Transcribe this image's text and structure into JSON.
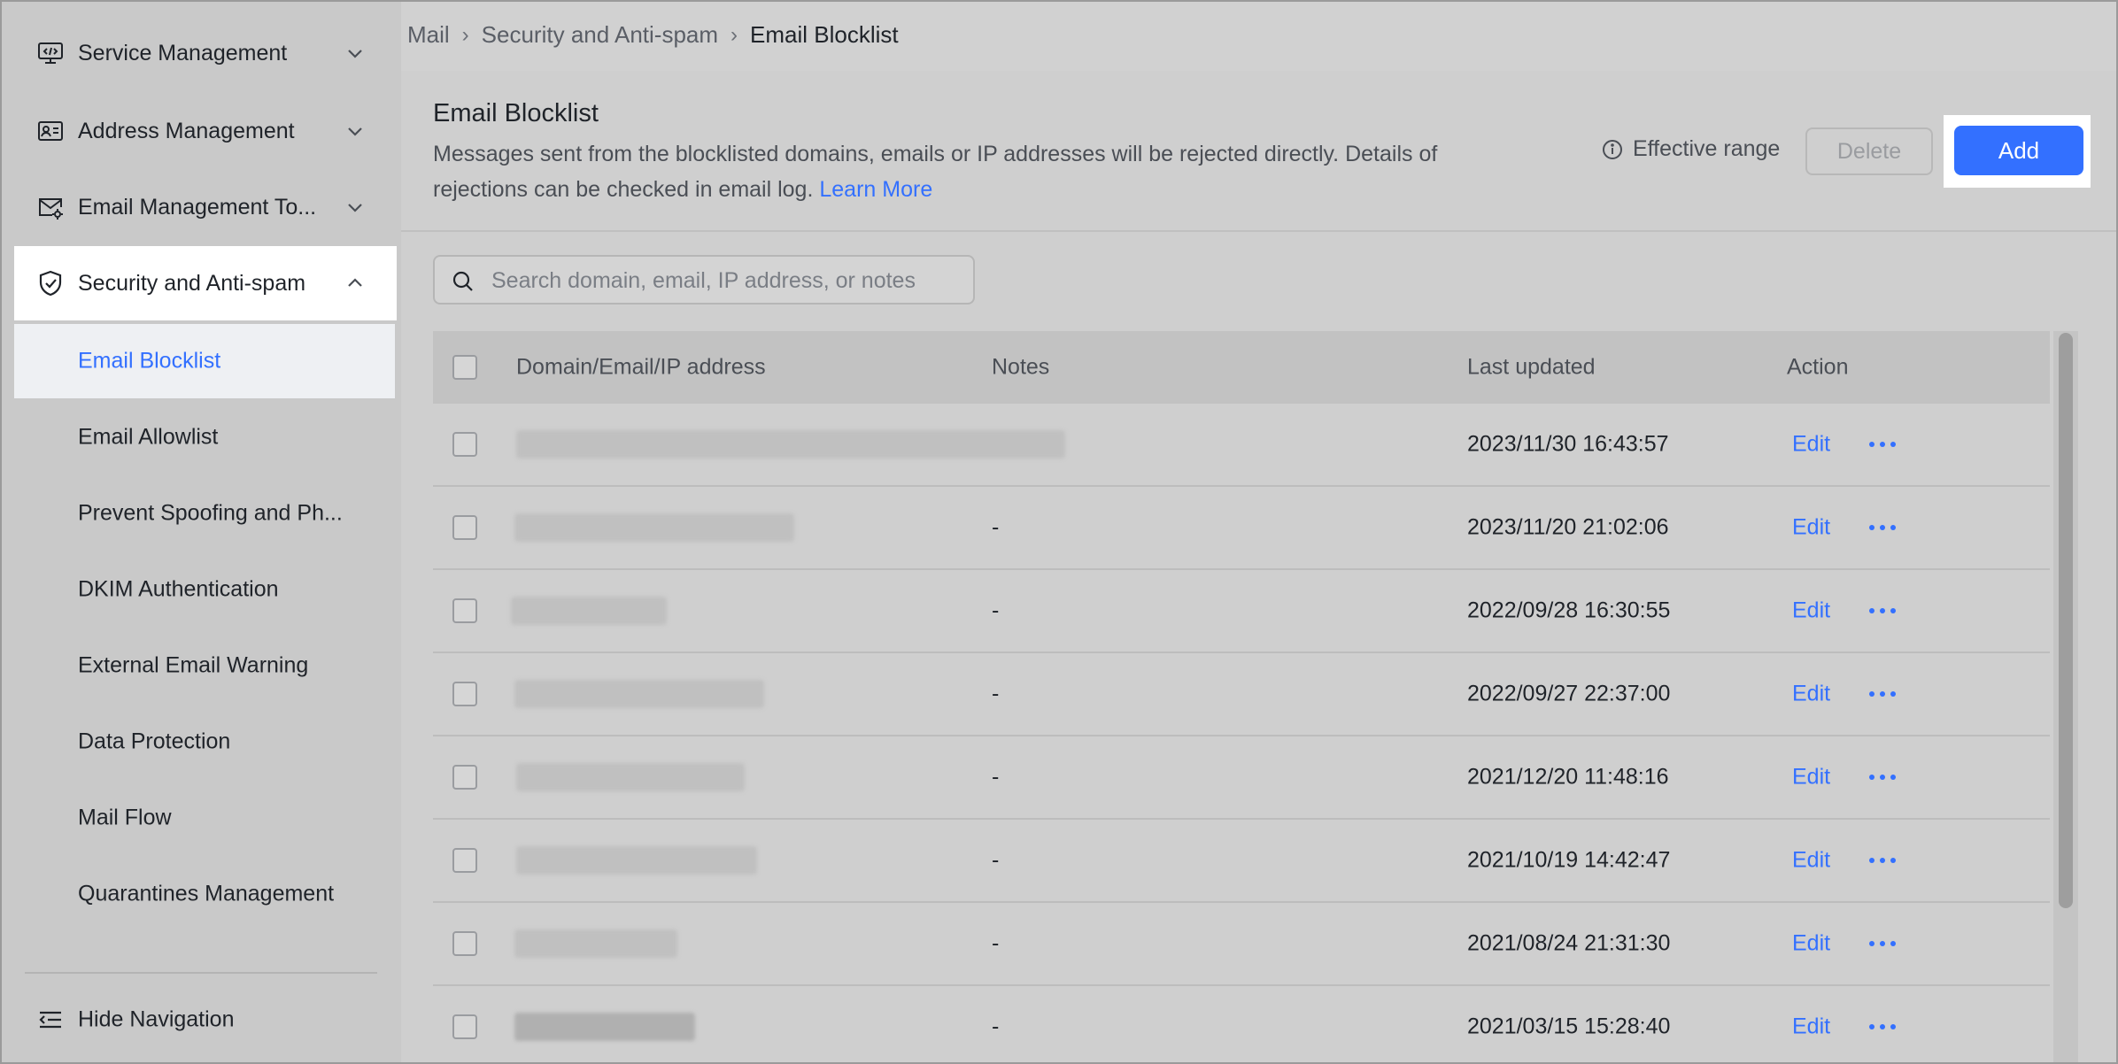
{
  "sidebar": {
    "items": [
      {
        "label": "Service Management",
        "icon": "monitor-code-icon",
        "expanded": false
      },
      {
        "label": "Address Management",
        "icon": "contact-card-icon",
        "expanded": false
      },
      {
        "label": "Email Management To...",
        "icon": "mail-settings-icon",
        "expanded": false
      },
      {
        "label": "Security and Anti-spam",
        "icon": "shield-check-icon",
        "expanded": true
      }
    ],
    "sub_items": [
      {
        "label": "Email Blocklist",
        "selected": true
      },
      {
        "label": "Email Allowlist"
      },
      {
        "label": "Prevent Spoofing and Ph..."
      },
      {
        "label": "DKIM Authentication"
      },
      {
        "label": "External Email Warning"
      },
      {
        "label": "Data Protection"
      },
      {
        "label": "Mail Flow"
      },
      {
        "label": "Quarantines Management"
      }
    ],
    "hide_nav_label": "Hide Navigation"
  },
  "breadcrumb": [
    "Mail",
    "Security and Anti-spam",
    "Email Blocklist"
  ],
  "header": {
    "title": "Email Blocklist",
    "description": "Messages sent from the blocklisted domains, emails or IP addresses will be rejected directly. Details of rejections can be checked in email log.",
    "learn_more": "Learn More",
    "effective_range": "Effective range",
    "delete_label": "Delete",
    "add_label": "Add"
  },
  "search": {
    "placeholder": "Search domain, email, IP address, or notes"
  },
  "table": {
    "columns": [
      "Domain/Email/IP address",
      "Notes",
      "Last updated",
      "Action"
    ],
    "edit_label": "Edit",
    "rows": [
      {
        "notes": "",
        "updated": "2023/11/30 16:43:57"
      },
      {
        "notes": "-",
        "updated": "2023/11/20 21:02:06"
      },
      {
        "notes": "-",
        "updated": "2022/09/28 16:30:55"
      },
      {
        "notes": "-",
        "updated": "2022/09/27 22:37:00"
      },
      {
        "notes": "-",
        "updated": "2021/12/20 11:48:16"
      },
      {
        "notes": "-",
        "updated": "2021/10/19 14:42:47"
      },
      {
        "notes": "-",
        "updated": "2021/08/24 21:31:30"
      },
      {
        "notes": "-",
        "updated": "2021/03/15 15:28:40"
      }
    ]
  },
  "colors": {
    "accent": "#3370ff",
    "overlay_bg": "#d1d1d1"
  }
}
